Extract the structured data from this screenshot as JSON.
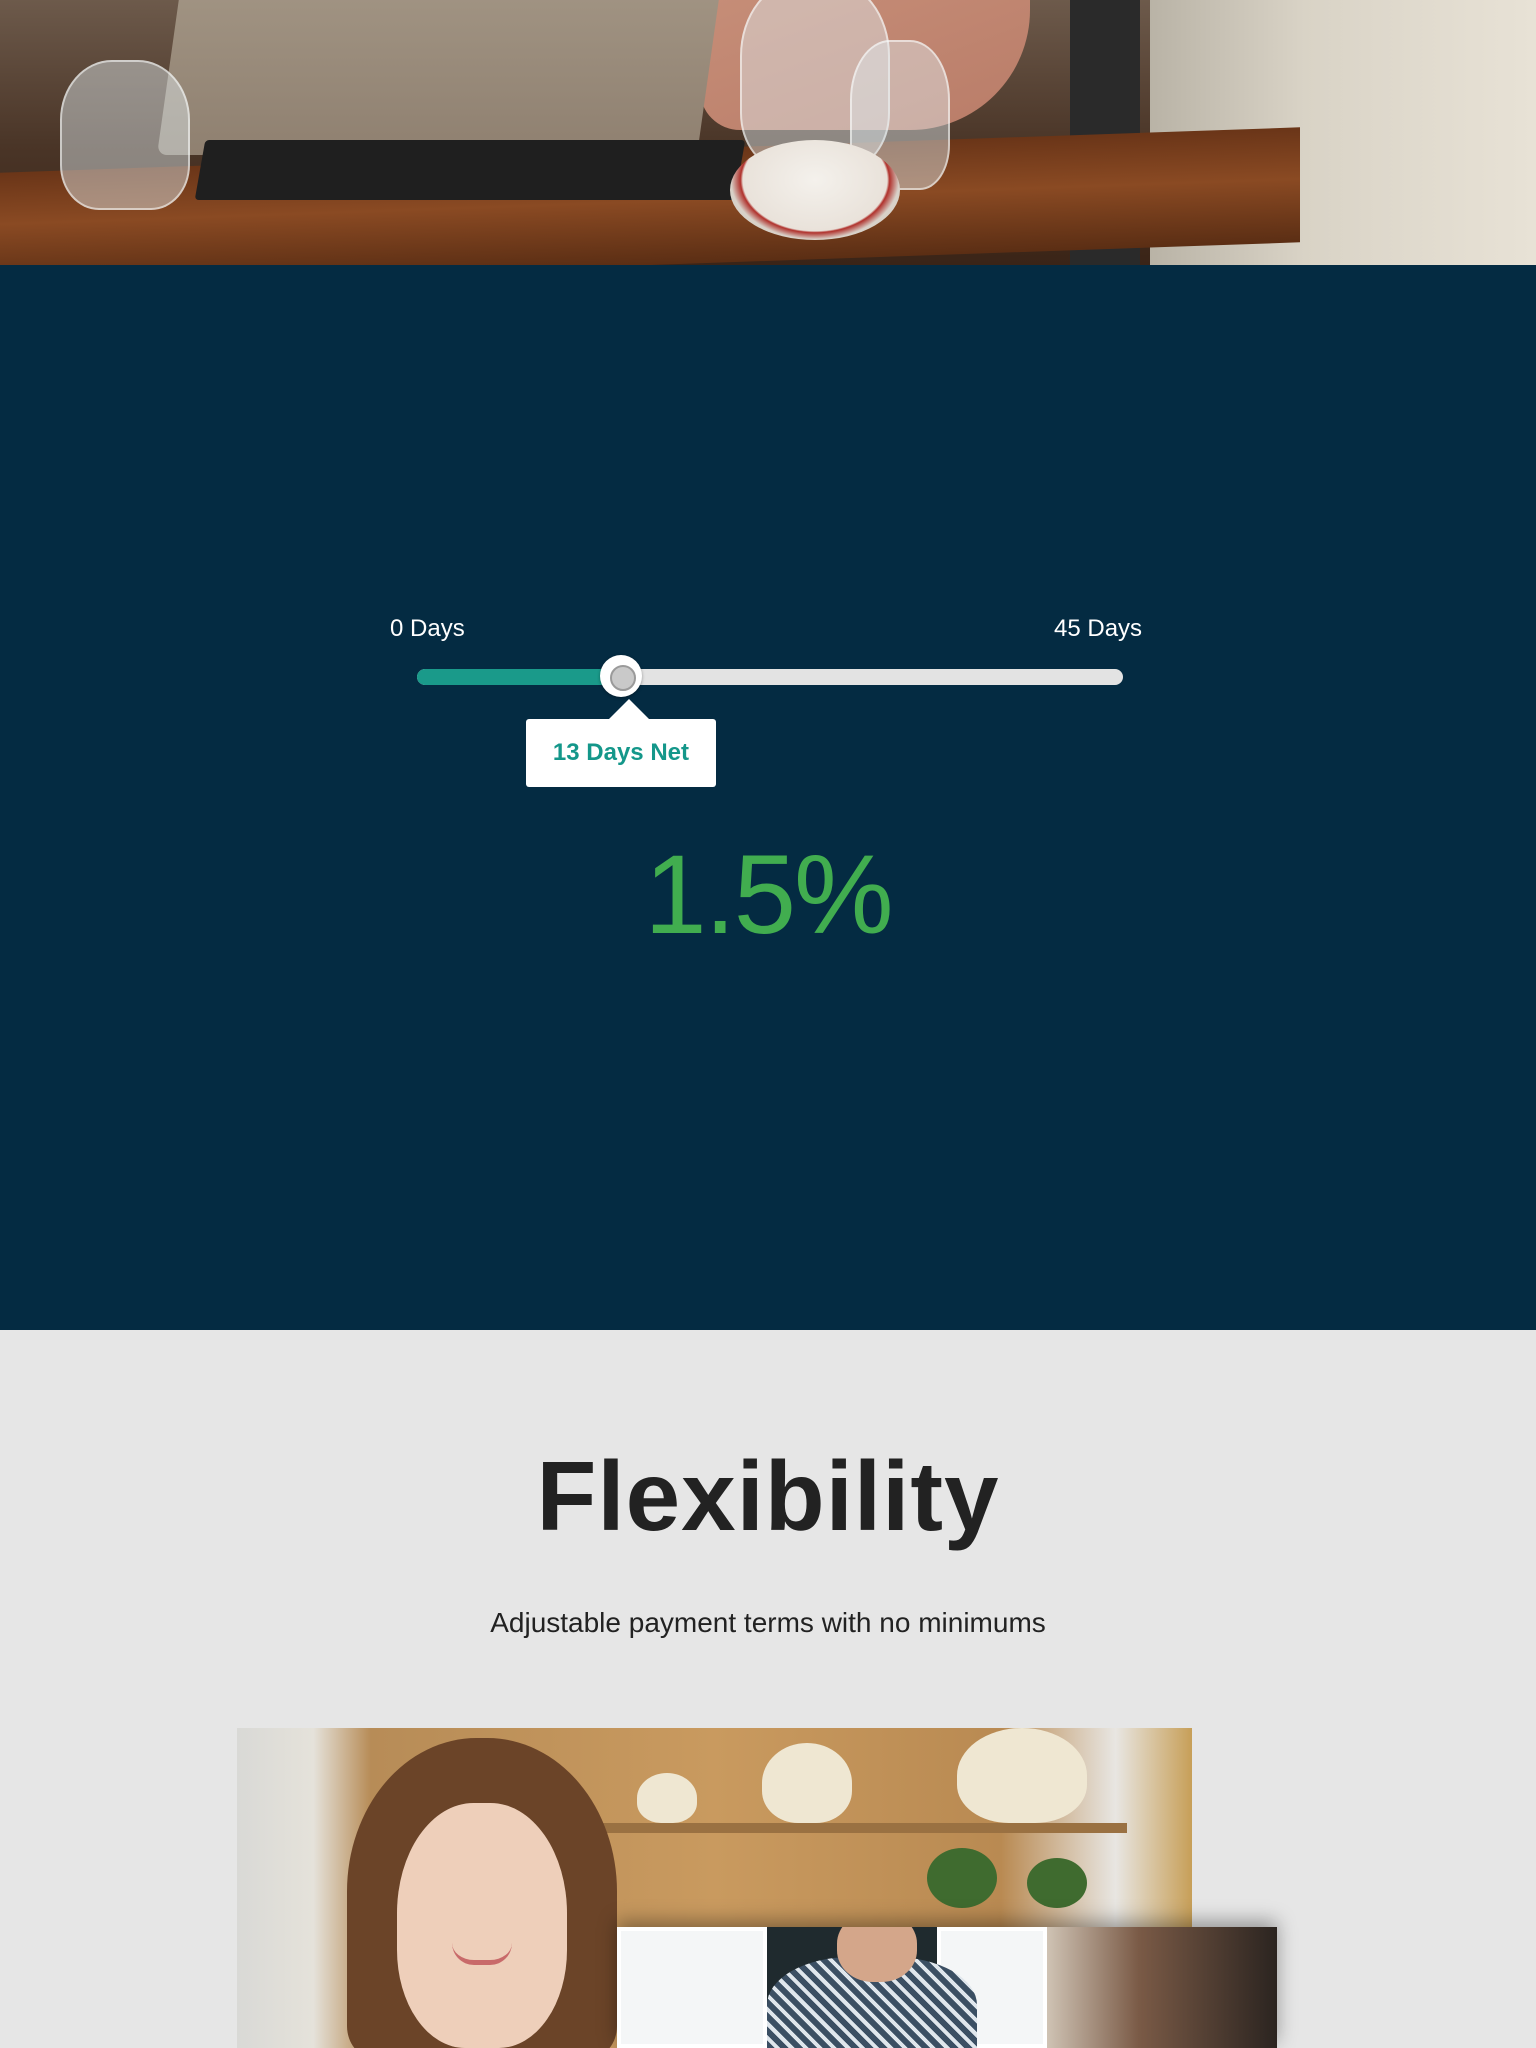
{
  "calculator": {
    "range_min_label": "0 Days",
    "range_max_label": "45 Days",
    "slider_value_days": 13,
    "slider_min_days": 0,
    "slider_max_days": 45,
    "tooltip_label": "13 Days Net",
    "rate_display": "1.5%",
    "colors": {
      "section_background": "#042b42",
      "slider_fill": "#1a9a8a",
      "tooltip_text": "#14978a",
      "rate_text": "#41ad4f"
    }
  },
  "flexibility": {
    "title": "Flexibility",
    "subtitle": "Adjustable payment terms with no minimums"
  }
}
